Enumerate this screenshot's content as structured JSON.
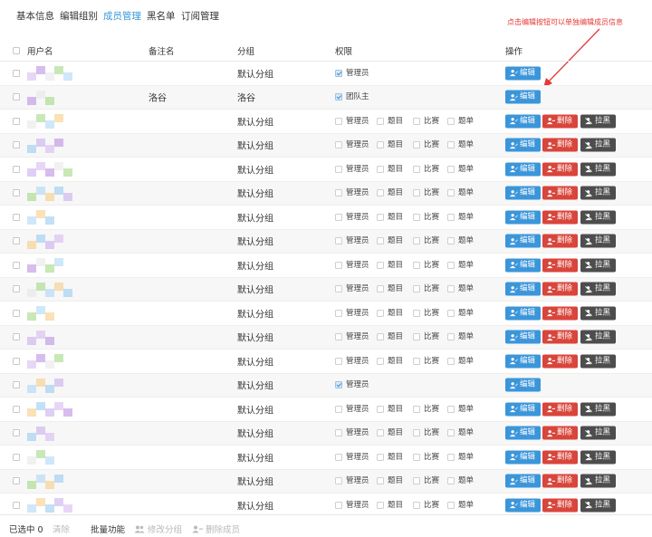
{
  "tabs": [
    {
      "label": "基本信息"
    },
    {
      "label": "编辑组别"
    },
    {
      "label": "成员管理"
    },
    {
      "label": "黑名单"
    },
    {
      "label": "订阅管理"
    }
  ],
  "active_tab": "成员管理",
  "annotation": "点击编辑按钮可以单独编辑成员信息",
  "colors": {
    "accent": "#3a9ad9",
    "edit": "#3b96d9",
    "delete": "#d9453b",
    "blacklist": "#4d4d4d",
    "annotation": "#e53935"
  },
  "table": {
    "headers": {
      "username": "用户名",
      "remark": "备注名",
      "group": "分组",
      "permission": "权限",
      "actions": "操作"
    },
    "permission_labels": {
      "admin": "管理员",
      "owner": "团队主",
      "problem": "题目",
      "contest": "比赛",
      "problemset": "题单"
    },
    "action_labels": {
      "edit": "编辑",
      "delete": "删除",
      "blacklist": "拉黑"
    },
    "rows": [
      {
        "remark": "",
        "group": "默认分组",
        "perm_type": "admin"
      },
      {
        "remark": "洛谷",
        "group": "洛谷",
        "perm_type": "owner"
      },
      {
        "remark": "",
        "group": "默认分组",
        "perm_type": "member"
      },
      {
        "remark": "",
        "group": "默认分组",
        "perm_type": "member"
      },
      {
        "remark": "",
        "group": "默认分组",
        "perm_type": "member"
      },
      {
        "remark": "",
        "group": "默认分组",
        "perm_type": "member"
      },
      {
        "remark": "",
        "group": "默认分组",
        "perm_type": "member"
      },
      {
        "remark": "",
        "group": "默认分组",
        "perm_type": "member"
      },
      {
        "remark": "",
        "group": "默认分组",
        "perm_type": "member"
      },
      {
        "remark": "",
        "group": "默认分组",
        "perm_type": "member"
      },
      {
        "remark": "",
        "group": "默认分组",
        "perm_type": "member"
      },
      {
        "remark": "",
        "group": "默认分组",
        "perm_type": "member"
      },
      {
        "remark": "",
        "group": "默认分组",
        "perm_type": "member"
      },
      {
        "remark": "",
        "group": "默认分组",
        "perm_type": "admin"
      },
      {
        "remark": "",
        "group": "默认分组",
        "perm_type": "member"
      },
      {
        "remark": "",
        "group": "默认分组",
        "perm_type": "member"
      },
      {
        "remark": "",
        "group": "默认分组",
        "perm_type": "member"
      },
      {
        "remark": "",
        "group": "默认分组",
        "perm_type": "member"
      },
      {
        "remark": "",
        "group": "默认分组",
        "perm_type": "member"
      }
    ]
  },
  "footer": {
    "selected_label": "已选中 0",
    "clear": "清除",
    "bulk_label": "批量功能",
    "change_group": "修改分组",
    "remove_member": "删除成员"
  }
}
